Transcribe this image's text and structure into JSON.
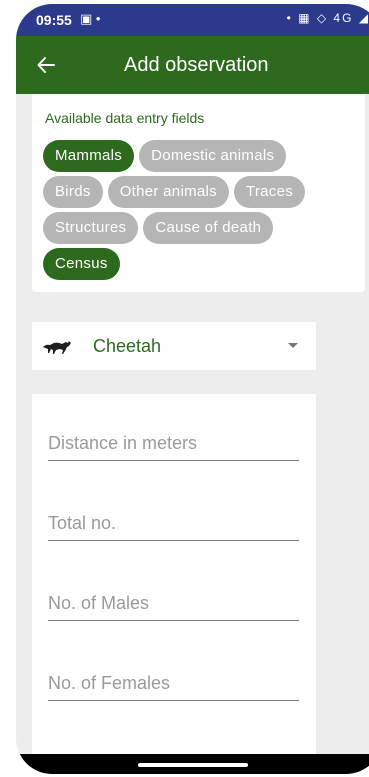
{
  "status_bar": {
    "time": "09:55",
    "left_icons": "▣  •",
    "right_icons": "• ▦ ◇ 4G ◢"
  },
  "app_bar": {
    "title": "Add observation",
    "back_icon": "arrow-left-icon"
  },
  "fields_card": {
    "title": "Available data entry fields",
    "chips": [
      {
        "label": "Mammals",
        "selected": true
      },
      {
        "label": "Domestic animals",
        "selected": false
      },
      {
        "label": "Birds",
        "selected": false
      },
      {
        "label": "Other animals",
        "selected": false
      },
      {
        "label": "Traces",
        "selected": false
      },
      {
        "label": "Structures",
        "selected": false
      },
      {
        "label": "Cause of death",
        "selected": false
      },
      {
        "label": "Census",
        "selected": true
      }
    ]
  },
  "species_select": {
    "icon": "cheetah-icon",
    "value": "Cheetah"
  },
  "form": {
    "distance_placeholder": "Distance in meters",
    "total_placeholder": "Total no.",
    "males_placeholder": "No. of Males",
    "females_placeholder": "No. of Females"
  },
  "colors": {
    "status_bar": "#2c3a8c",
    "primary": "#2e6a1e",
    "chip_unselected": "#b5b5b5",
    "background": "#ededed"
  }
}
